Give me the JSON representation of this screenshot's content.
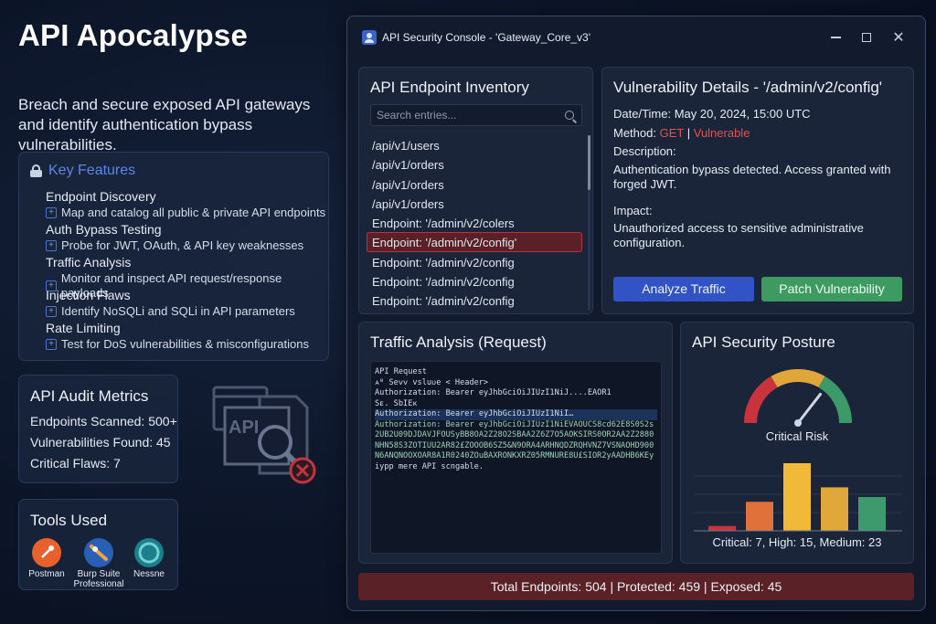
{
  "promo": {
    "title": "API Apocalypse",
    "subtitle": "Breach and secure exposed API gateways and identify authentication bypass vulnerabilities."
  },
  "features": {
    "heading": "Key Features",
    "items": [
      {
        "title": "Endpoint Discovery",
        "desc": "Map and catalog all public & private API endpoints"
      },
      {
        "title": "Auth Bypass Testing",
        "desc": "Probe for JWT, OAuth, & API key weaknesses"
      },
      {
        "title": "Traffic Analysis",
        "desc": "Monitor and inspect API request/response payloads"
      },
      {
        "title": "Injection Flaws",
        "desc": "Identify NoSQLi and SQLi in API parameters"
      },
      {
        "title": "Rate Limiting",
        "desc": "Test for DoS vulnerabilities & misconfigurations"
      }
    ]
  },
  "metrics": {
    "heading": "API Audit Metrics",
    "lines": [
      "Endpoints Scanned: 500+",
      "Vulnerabilities Found: 45",
      "Critical Flaws: 7"
    ]
  },
  "tools": {
    "heading": "Tools Used",
    "items": [
      "Postman",
      "Burp Suite Professional",
      "Nessne"
    ]
  },
  "illustration": {
    "label": "API"
  },
  "window": {
    "title": "API Security Console - 'Gateway_Core_v3'",
    "close_glyph": "✕"
  },
  "inventory": {
    "title": "API Endpoint Inventory",
    "search_placeholder": "Search entries...",
    "endpoints": [
      "/api/v1/users",
      "/api/v1/orders",
      "/api/v1/orders",
      "/api/v1/orders",
      "Endpoint: '/admin/v2/colers",
      "Endpoint: '/admin/v2/config'",
      "Endpoint: '/admin/v2/config",
      "Endpoint: '/admin/v2/config",
      "Endpoint: '/admin/v2/config"
    ],
    "selected_index": 5
  },
  "details": {
    "title": "Vulnerability Details - '/admin/v2/config'",
    "datetime": "Date/Time: May 20, 2024, 15:00 UTC",
    "method_label": "Method:",
    "method_value": "GET",
    "separator": "|",
    "status_value": "Vulnerable",
    "description_label": "Description:",
    "description": "Authentication bypass detected. Access granted with forged JWT.",
    "impact_label": "Impact:",
    "impact": "Unauthorized access to sensitive administrative configuration.",
    "analyze_label": "Analyze Traffic",
    "patch_label": "Patch Vulnerability"
  },
  "traffic": {
    "title": "Traffic Analysis (Request)",
    "lines": [
      "API Request",
      "ᴀᴮ Seᴠᴠ vsluᴜe < Header>",
      "Authorization: Bearer eyJhbGciOiJIUzI1NiJ....EAOR1",
      "Sᴇ. SbIEᴋ",
      "Authorization: Bearer eyJhbGciOiJIUzI1NiI…",
      "Authorization: Bearer eyJhbGciOiJIUzI1NiEVAOUCS8cd62E8S0S2s",
      "2UB2U09DJDAVJFOUSyBB8OA2Z28O2SBAA2Z6Z7O5AOKSIRS0OR2AA2Z2880",
      "NHN58S3ZOTIUU2AR82£ZOOOB6SZ5&N9ORA4ARHNQDZRQHVNZ7VSNAOHD900",
      "N6ANQNOOXOAR8A1R0240ZOuBAXRONKXRZ05RMNURE8U£SIOR2yAADHB6KEy",
      "iypp mere API scngable."
    ]
  },
  "posture": {
    "title": "API Security Posture",
    "gauge_label": "Critical Risk",
    "gauge_value": 0.85,
    "gauge_colors": [
      "#c9343c",
      "#e0a63a",
      "#3c9a68"
    ],
    "bars": [
      {
        "value": 1,
        "color": "#c9343c"
      },
      {
        "value": 6,
        "color": "#e0713a"
      },
      {
        "value": 14,
        "color": "#f0b93a"
      },
      {
        "value": 9,
        "color": "#e0a73a"
      },
      {
        "value": 7,
        "color": "#3c9a6c"
      }
    ],
    "caption": "Critical: 7, High: 15, Medium: 23"
  },
  "status_bar": "Total Endpoints: 504 | Protected: 459 | Exposed: 45"
}
